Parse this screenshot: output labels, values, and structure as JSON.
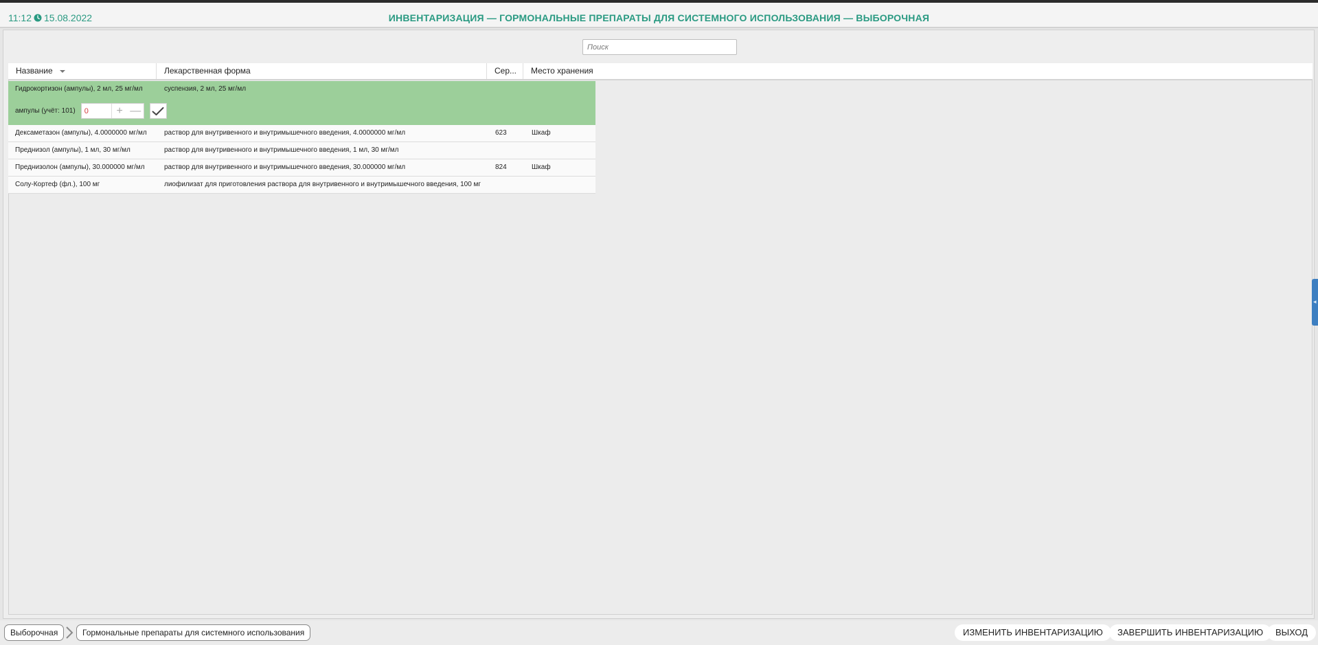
{
  "header": {
    "time": "11:12",
    "date": "15.08.2022",
    "title": "ИНВЕНТАРИЗАЦИЯ — ГОРМОНАЛЬНЫЕ ПРЕПАРАТЫ ДЛЯ СИСТЕМНОГО ИСПОЛЬЗОВАНИЯ — ВЫБОРОЧНАЯ"
  },
  "search": {
    "placeholder": "Поиск"
  },
  "table": {
    "columns": [
      "Название",
      "Лекарственная форма",
      "Сер...",
      "Место хранения"
    ],
    "active_row": {
      "name": "Гидрокортизон (ампулы), 2 мл, 25 мг/мл",
      "form": "суспензия, 2 мл, 25 мг/мл",
      "qty_label": "ампулы (учёт: 101)",
      "qty_value": "0",
      "plus": "+",
      "minus": "—"
    },
    "rows": [
      {
        "name": "Дексаметазон (ампулы), 4.0000000 мг/мл",
        "form": "раствор для внутривенного и внутримышечного введения, 4.0000000 мг/мл",
        "series": "623",
        "storage": "Шкаф"
      },
      {
        "name": "Преднизол (ампулы), 1 мл, 30 мг/мл",
        "form": "раствор для внутривенного и внутримышечного введения, 1 мл, 30 мг/мл",
        "series": "",
        "storage": ""
      },
      {
        "name": "Преднизолон (ампулы), 30.000000 мг/мл",
        "form": "раствор для внутривенного и внутримышечного введения, 30.000000 мг/мл",
        "series": "824",
        "storage": "Шкаф"
      },
      {
        "name": "Солу-Кортеф (фл.), 100 мг",
        "form": "лиофилизат для приготовления раствора для внутривенного и внутримышечного введения, 100 мг",
        "series": "",
        "storage": ""
      }
    ]
  },
  "footer": {
    "breadcrumbs": [
      "Выборочная",
      "Гормональные препараты для системного использования"
    ],
    "buttons": {
      "edit": "ИЗМЕНИТЬ ИНВЕНТАРИЗАЦИЮ",
      "finish": "ЗАВЕРШИТЬ ИНВЕНТАРИЗАЦИЮ",
      "exit": "ВЫХОД"
    }
  },
  "colors": {
    "accent": "#2a9a82",
    "active_row": "#9ccf9a",
    "side_handle": "#3d7fc1",
    "qty_value": "#d23b3b"
  }
}
